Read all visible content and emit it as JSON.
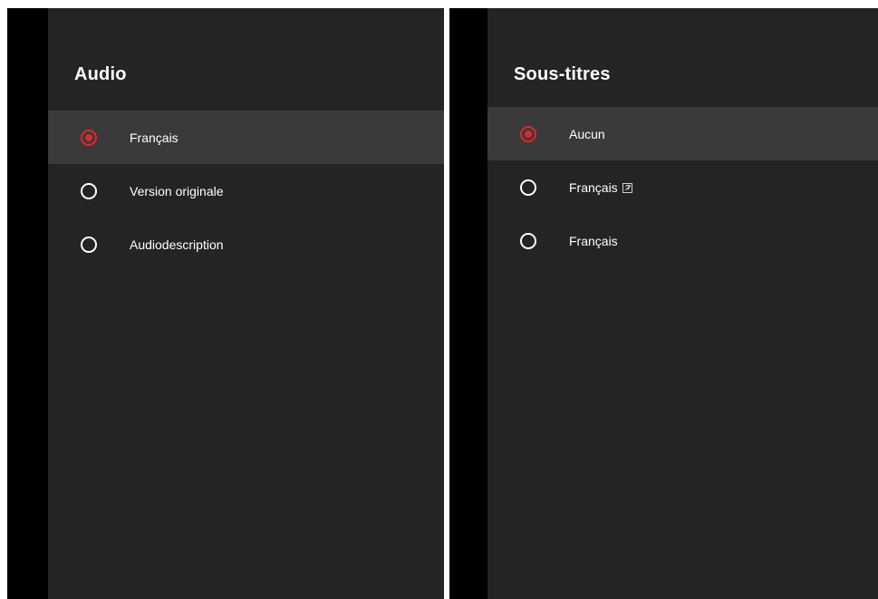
{
  "audio_panel": {
    "title": "Audio",
    "options": [
      {
        "label": "Français",
        "selected": true
      },
      {
        "label": "Version originale",
        "selected": false
      },
      {
        "label": "Audiodescription",
        "selected": false
      }
    ]
  },
  "subtitles_panel": {
    "title": "Sous-titres",
    "options": [
      {
        "label": "Aucun",
        "selected": true
      },
      {
        "label": "Français",
        "selected": false,
        "icon": "hard-of-hearing-icon"
      },
      {
        "label": "Français",
        "selected": false
      }
    ]
  },
  "colors": {
    "panel_background": "#242424",
    "selected_row": "#3a3a3a",
    "accent_red": "#e3262b",
    "side_strip": "#000000",
    "text": "#ffffff"
  }
}
